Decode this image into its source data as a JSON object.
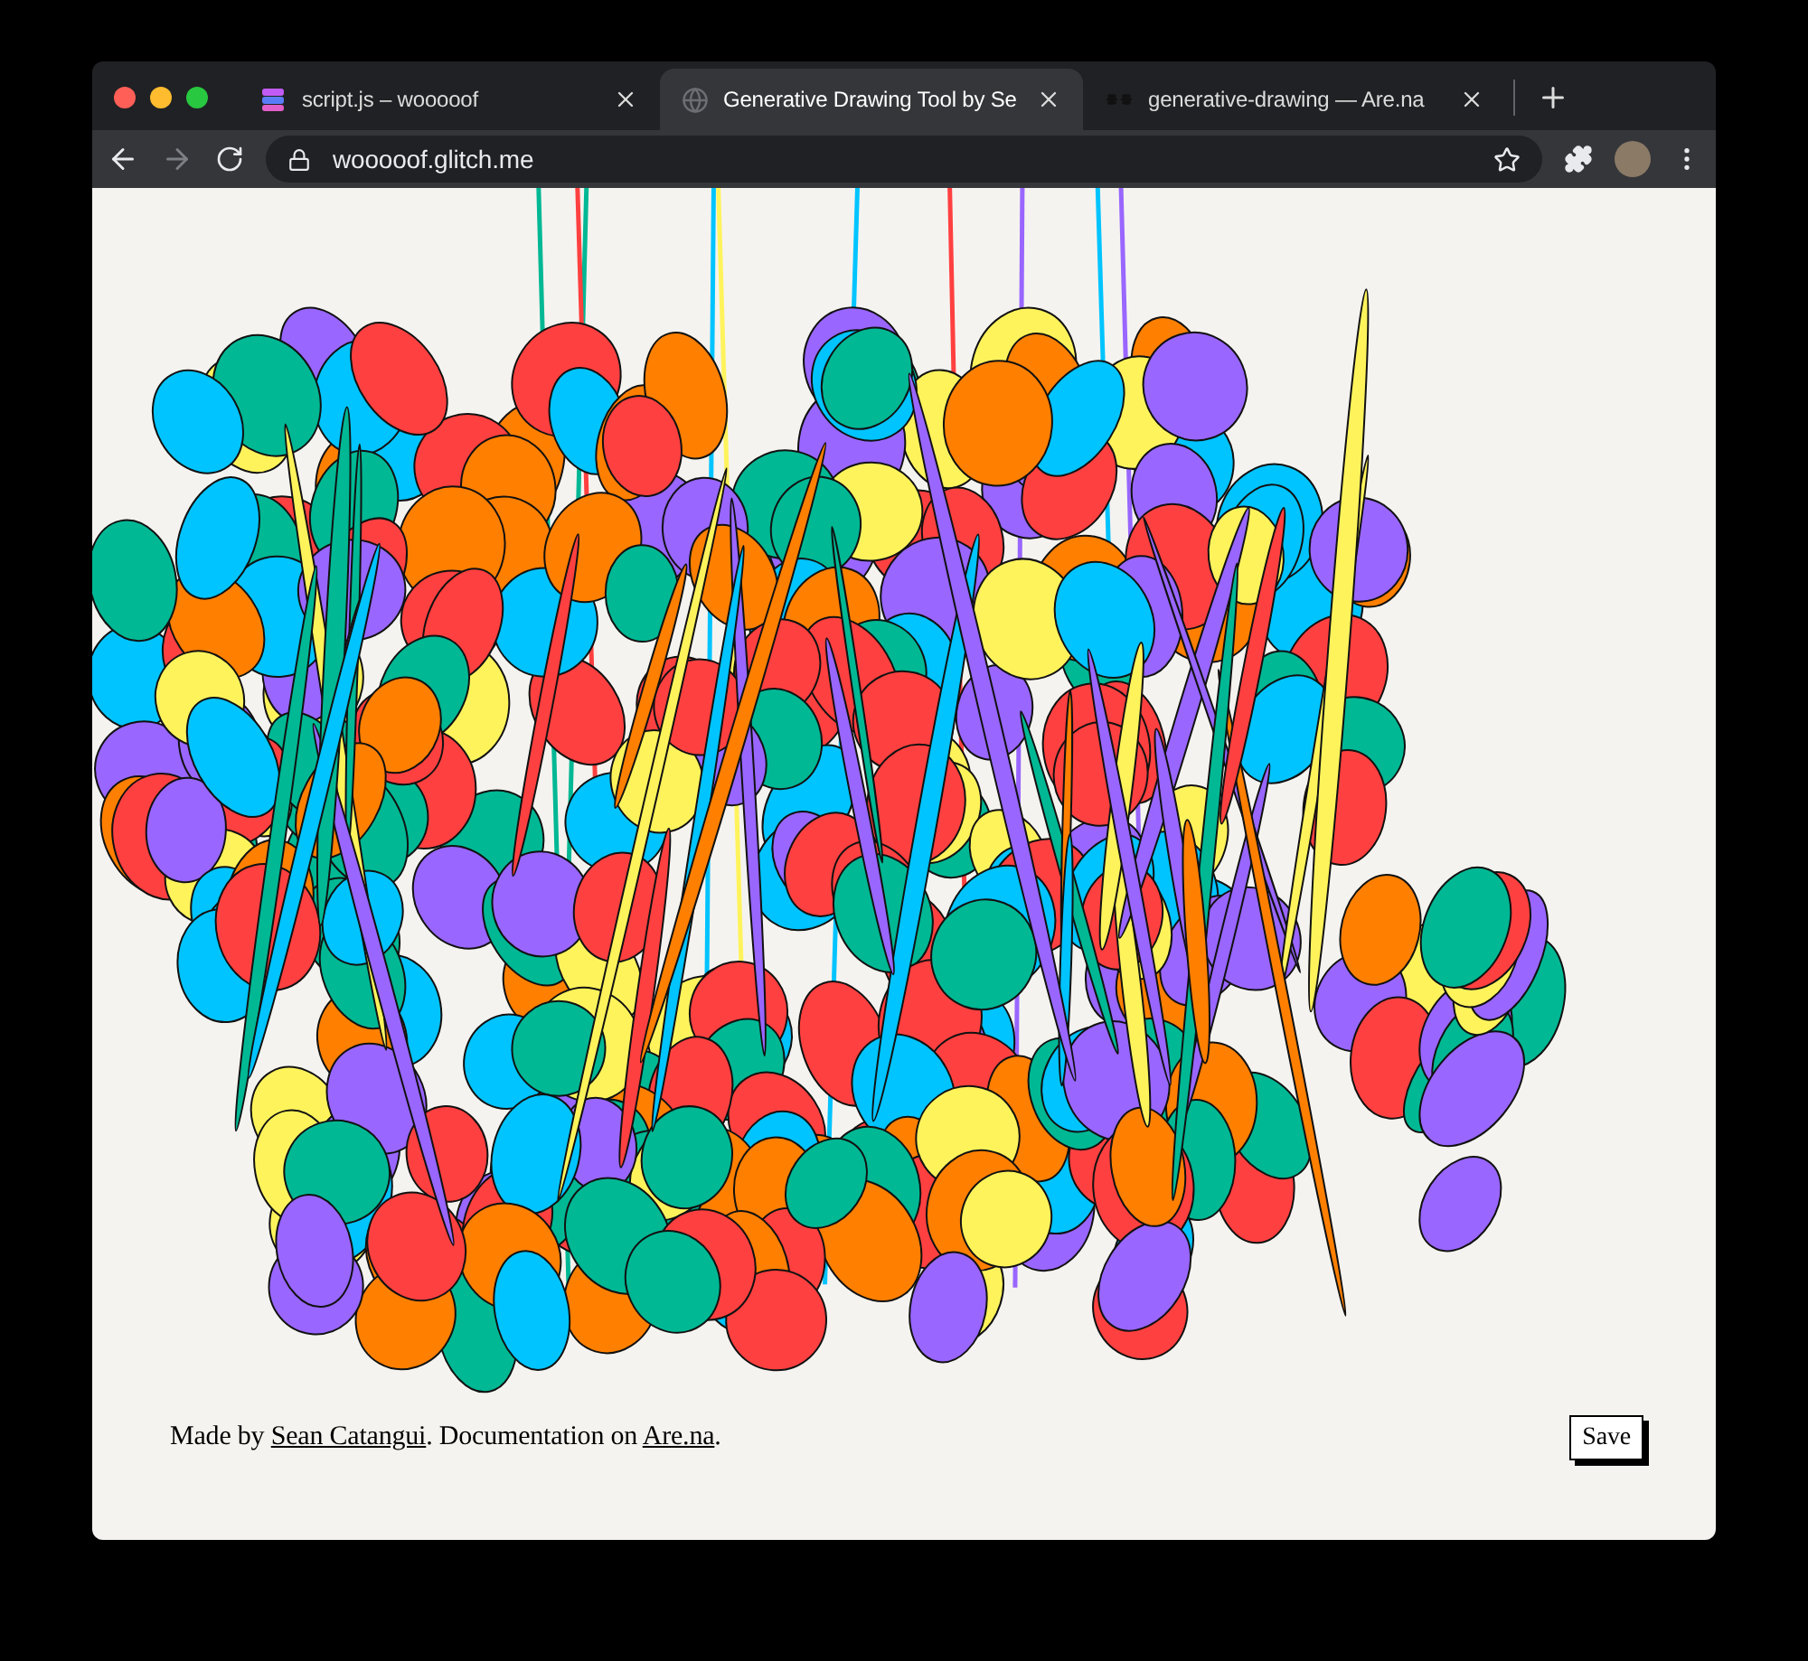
{
  "tabs": [
    {
      "title": "script.js – wooooof",
      "selected": false,
      "kind": "stack"
    },
    {
      "title": "Generative Drawing Tool by Se",
      "selected": true,
      "kind": "globe"
    },
    {
      "title": "generative-drawing — Are.na",
      "selected": false,
      "kind": "asterisks"
    }
  ],
  "toolbar": {
    "back_disabled": false,
    "forward_disabled": true,
    "url": "wooooof.glitch.me"
  },
  "footer": {
    "prefix": "Made by ",
    "author_link": "Sean Catangui",
    "middle": ". Documentation on ",
    "docs_link": "Are.na",
    "suffix": "."
  },
  "save_button": "Save"
}
